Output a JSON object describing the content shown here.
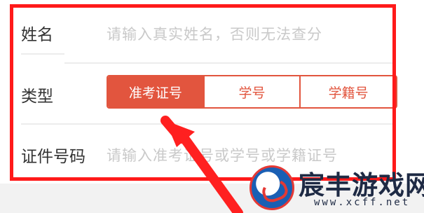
{
  "form": {
    "name_label": "姓名",
    "name_placeholder": "请输入真实姓名，否则无法查分",
    "type_label": "类型",
    "type_options": [
      "准考证号",
      "学号",
      "学籍号"
    ],
    "type_selected": "准考证号",
    "id_label": "证件号码",
    "id_placeholder": "请输入准考证号或学号或学籍证号"
  },
  "watermark": {
    "title": "宸丰游戏网",
    "url": "www.xcff.net"
  },
  "colors": {
    "accent": "#e2553e",
    "highlight_frame": "#ff1a1a",
    "arrow": "#ff2020",
    "placeholder": "#c9c9c9"
  },
  "icons": {
    "watermark_logo": "dragon-logo-icon",
    "annotation": "red-arrow-icon"
  }
}
